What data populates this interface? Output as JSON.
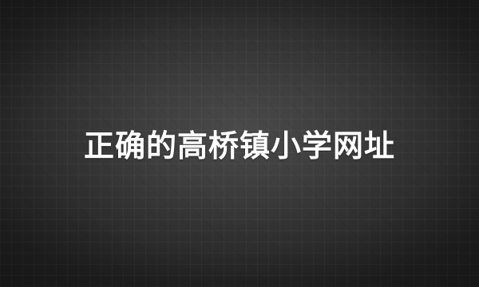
{
  "title": "正确的高桥镇小学网址",
  "colors": {
    "background_center": "#4a4a4a",
    "background_edge": "#222222",
    "text": "#ffffff"
  }
}
